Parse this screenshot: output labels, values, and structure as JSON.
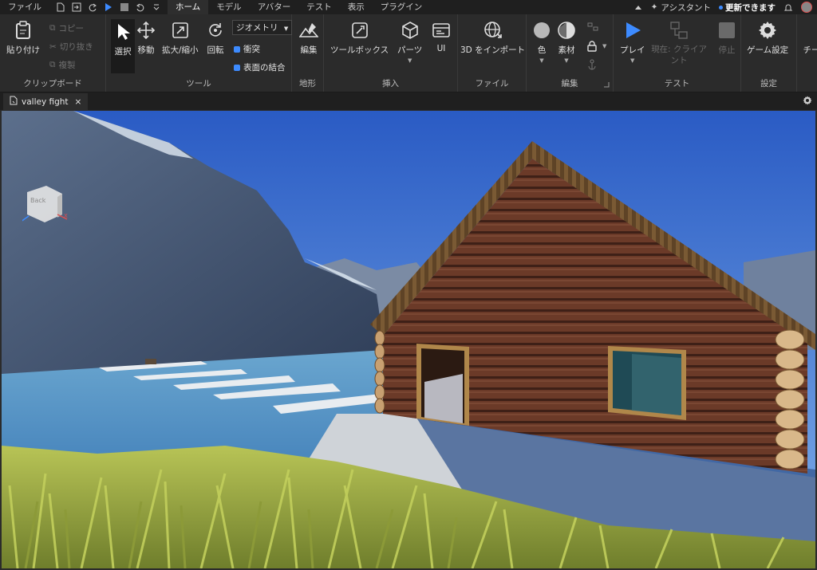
{
  "menubar": {
    "file": "ファイル",
    "tabs": [
      {
        "label": "ホーム",
        "active": true
      },
      {
        "label": "モデル"
      },
      {
        "label": "アバター"
      },
      {
        "label": "テスト"
      },
      {
        "label": "表示"
      },
      {
        "label": "プラグイン"
      }
    ],
    "assistant": "アシスタント",
    "update": "更新できます"
  },
  "ribbon": {
    "clipboard": {
      "label": "クリップボード",
      "paste": "貼り付け",
      "copy": "コピー",
      "cut": "切り抜き",
      "duplicate": "複製"
    },
    "tools": {
      "label": "ツール",
      "select": "選択",
      "move": "移動",
      "scale": "拡大/縮小",
      "rotate": "回転",
      "geometry": "ジオメトリ",
      "collide": "衝突",
      "join": "表面の結合"
    },
    "terrain": {
      "label": "地形",
      "edit": "編集"
    },
    "insert": {
      "label": "挿入",
      "toolbox": "ツールボックス",
      "part": "パーツ",
      "ui": "UI"
    },
    "file": {
      "label": "ファイル",
      "import3d": "3D をインポート"
    },
    "edit": {
      "label": "編集",
      "color": "色",
      "material": "素材"
    },
    "test": {
      "label": "テスト",
      "play": "プレイ",
      "current": "現在: クライアント",
      "stop": "停止"
    },
    "settings": {
      "label": "設定",
      "game_settings": "ゲーム設定",
      "overflow": "チー"
    }
  },
  "document": {
    "tab_title": "valley fight",
    "close": "×"
  },
  "viewport": {
    "viewcube_label": "Back"
  },
  "colors": {
    "accent": "#3d8bff",
    "sky_top": "#2f62c8",
    "water": "#4f8fbf",
    "wood": "#6b3a28",
    "grass": "#a8b54a"
  }
}
